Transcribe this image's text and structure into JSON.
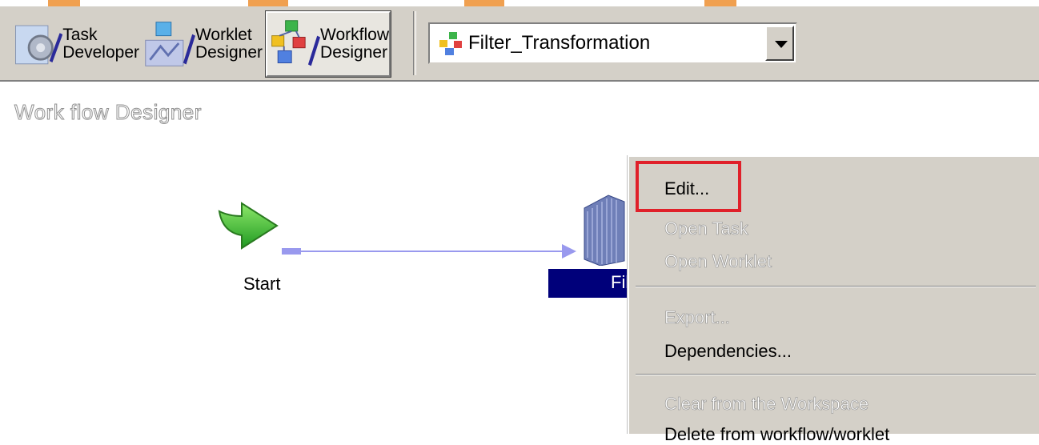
{
  "toolbar": {
    "buttons": [
      {
        "line1": "Task",
        "line2": "Developer"
      },
      {
        "line1": "Worklet",
        "line2": "Designer"
      },
      {
        "line1": "Workflow",
        "line2": "Designer"
      }
    ],
    "workflow_select": {
      "value": "Filter_Transformation"
    }
  },
  "canvas": {
    "title": "Work flow Designer",
    "start_task": {
      "label": "Start"
    },
    "session_task": {
      "label": "Fil"
    }
  },
  "context_menu": {
    "items": [
      {
        "label": "Edit...",
        "enabled": true,
        "highlighted": true
      },
      {
        "label": "Open Task",
        "enabled": false
      },
      {
        "label": "Open Worklet",
        "enabled": false
      },
      {
        "label": "Export...",
        "enabled": false
      },
      {
        "label": "Dependencies...",
        "enabled": true
      },
      {
        "label": "Clear from the Workspace",
        "enabled": false
      },
      {
        "label": "Delete from workflow/worklet",
        "enabled": true
      }
    ]
  },
  "colors": {
    "toolbar_bg": "#d4d0c8",
    "selection_bg": "#00007a",
    "highlight_border": "#e0202a",
    "link_line": "#9999ee"
  }
}
